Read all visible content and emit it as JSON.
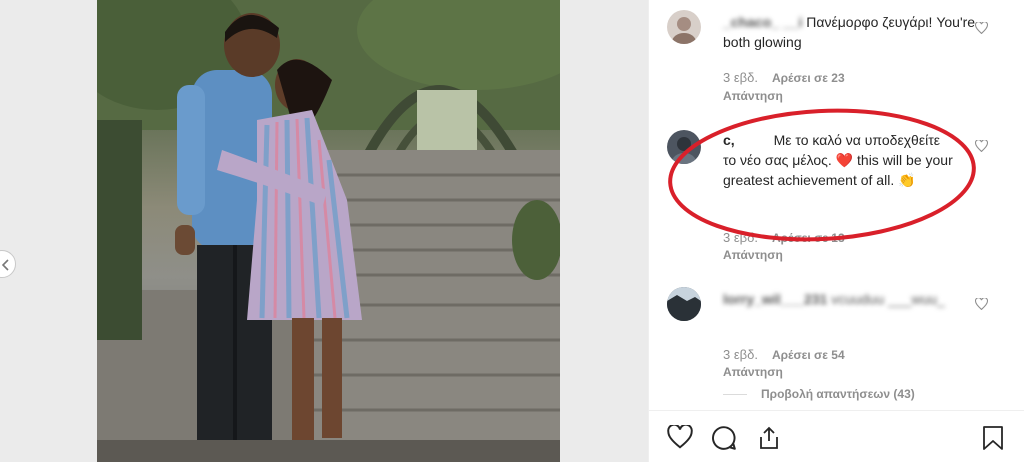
{
  "comments": [
    {
      "username": "_chaco_ __i",
      "text": " Πανέμορφο ζευγάρι! You're both glowing",
      "time": "3 εβδ.",
      "likes": "Αρέσει σε 23",
      "reply": "Απάντηση"
    },
    {
      "username": "c,",
      "text": "Με το καλό να υποδεχθείτε το νέο σας μέλος. ❤️ this will be your greatest achievement of all. 👏",
      "time": "3 εβδ.",
      "likes": "Αρέσει σε 13",
      "reply": "Απάντηση"
    },
    {
      "username": "lorry_wil___231",
      "text": "vcuuduu ___wuu_",
      "time": "3 εβδ.",
      "likes": "Αρέσει σε 54",
      "reply": "Απάντηση"
    }
  ],
  "view_replies": "Προβολή απαντήσεων (43)",
  "colors": {
    "annotation": "#d9202a",
    "heart": "#e0245e"
  }
}
